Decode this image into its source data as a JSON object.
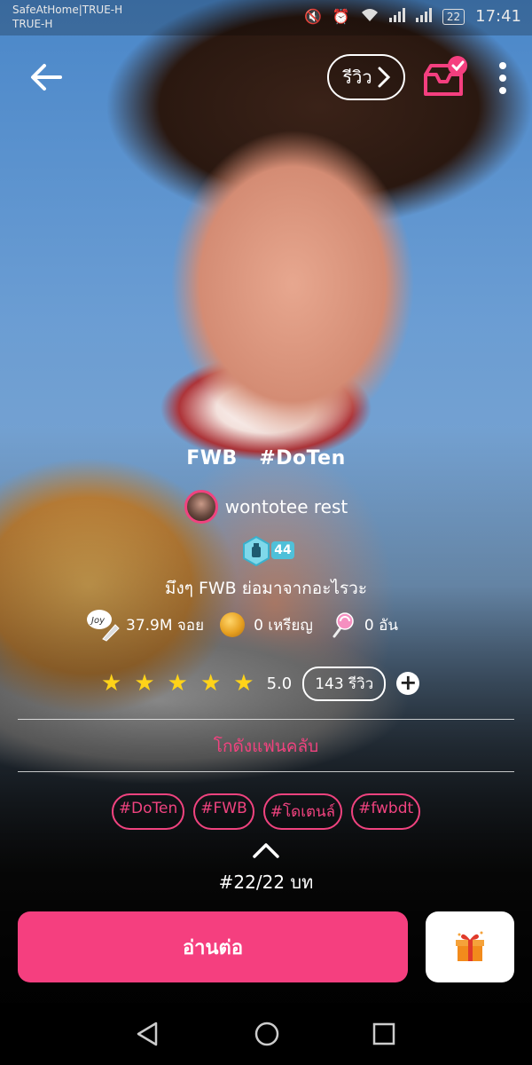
{
  "status_bar": {
    "carrier_line1": "SafeAtHome|TRUE-H",
    "carrier_line2": "TRUE-H",
    "battery": "22",
    "time": "17:41"
  },
  "header": {
    "review_label": "รีวิว"
  },
  "story": {
    "title": "FWB   #DoTen",
    "author": "wontotee rest",
    "level": "44",
    "description": "มึงๆ FWB ย่อมาจากอะไรวะ",
    "views": "37.9M จอย",
    "coins": "0 เหรียญ",
    "candies": "0 อัน",
    "joy_label": "Joy",
    "rating": "5.0",
    "rating_stars": 5,
    "review_count": "143 รีวิว",
    "fanclub": "โกดังแฟนคลับ",
    "tags": [
      "#DoTen",
      "#FWB",
      "#โดเตนล์",
      "#fwbdt"
    ],
    "episodes": "#22/22 บท"
  },
  "actions": {
    "read_label": "อ่านต่อ"
  },
  "colors": {
    "accent": "#f53f7f",
    "star": "#ffd319"
  }
}
